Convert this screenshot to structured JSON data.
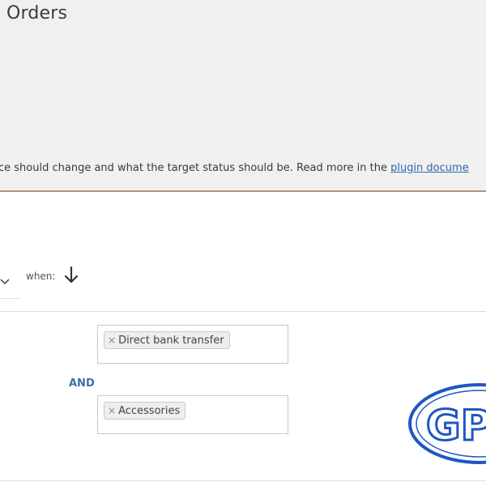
{
  "page": {
    "title": "Orders",
    "description": "ce should change and what the target status should be. Read more in the ",
    "link_text": "plugin docume"
  },
  "rule": {
    "when_label": "when:",
    "operator_label": "AND",
    "conditions": [
      {
        "chip_label": "Direct bank transfer",
        "remove_symbol": "×"
      },
      {
        "chip_label": "Accessories",
        "remove_symbol": "×"
      }
    ]
  },
  "watermark": {
    "text": "GP",
    "color": "#1f57c3"
  },
  "colors": {
    "panel_bg": "#f0f0f0",
    "panel_border": "#b98f76",
    "link": "#2f66b0",
    "operator": "#3d6fa8"
  },
  "icons": {
    "dropdown": "chevron-down-icon",
    "move": "arrow-down-icon",
    "chip_remove": "close-icon"
  }
}
